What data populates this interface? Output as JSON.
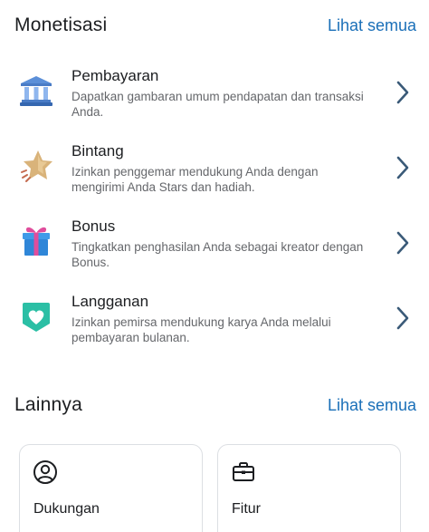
{
  "monetization": {
    "title": "Monetisasi",
    "see_all": "Lihat semua",
    "items": [
      {
        "icon": "bank-icon",
        "title": "Pembayaran",
        "description": "Dapatkan gambaran umum pendapatan dan transaksi Anda."
      },
      {
        "icon": "star-icon",
        "title": "Bintang",
        "description": "Izinkan penggemar mendukung Anda dengan mengirimi Anda Stars dan hadiah."
      },
      {
        "icon": "gift-icon",
        "title": "Bonus",
        "description": "Tingkatkan penghasilan Anda sebagai kreator dengan Bonus."
      },
      {
        "icon": "heart-shield-icon",
        "title": "Langganan",
        "description": "Izinkan pemirsa mendukung karya Anda melalui pembayaran bulanan."
      }
    ]
  },
  "others": {
    "title": "Lainnya",
    "see_all": "Lihat semua",
    "cards": [
      {
        "icon": "person-circle-icon",
        "label": "Dukungan"
      },
      {
        "icon": "briefcase-icon",
        "label": "Fitur"
      }
    ]
  },
  "colors": {
    "link": "#1a6fb8",
    "chevron": "#3a5a78",
    "text_secondary": "#65676b"
  }
}
